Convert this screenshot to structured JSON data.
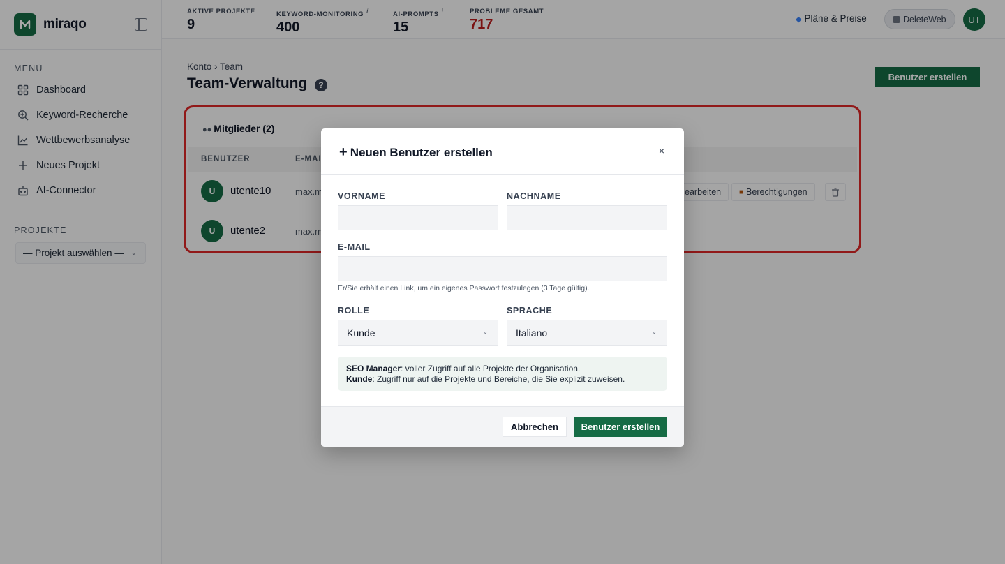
{
  "brand": {
    "name": "miraqo",
    "logo_letter": "M"
  },
  "sidebar": {
    "menu_label": "MENÜ",
    "items": [
      {
        "label": "Dashboard",
        "icon": "grid-icon"
      },
      {
        "label": "Keyword-Recherche",
        "icon": "search-plus-icon"
      },
      {
        "label": "Wettbewerbsanalyse",
        "icon": "line-chart-icon"
      },
      {
        "label": "Neues Projekt",
        "icon": "plus-icon"
      },
      {
        "label": "AI-Connector",
        "icon": "robot-icon"
      }
    ],
    "projects_label": "PROJEKTE",
    "project_select": "— Projekt auswählen —"
  },
  "topbar": {
    "stats": [
      {
        "label": "AKTIVE PROJEKTE",
        "value": "9",
        "info": ""
      },
      {
        "label": "KEYWORD-MONITORING",
        "value": "400",
        "info": "i"
      },
      {
        "label": "AI-PROMPTS",
        "value": "15",
        "info": "i"
      },
      {
        "label": "PROBLEME GESAMT",
        "value": "717",
        "info": ""
      }
    ],
    "plans_label": "Pläne & Preise",
    "workspace_label": "DeleteWeb",
    "avatar_initials": "UT"
  },
  "main": {
    "breadcrumb": "Konto › Team",
    "title": "Team-Verwaltung",
    "help": "?",
    "create_button": "Benutzer erstellen",
    "members": {
      "title": "Mitglieder (2)",
      "columns": [
        "BENUTZER",
        "E-MAIL"
      ],
      "rows": [
        {
          "avatar": "U",
          "name": "utente10",
          "email": "max.m"
        },
        {
          "avatar": "U",
          "name": "utente2",
          "email": "max.m"
        }
      ],
      "edit_label": "earbeiten",
      "permissions_label": "Berechtigungen"
    }
  },
  "modal": {
    "title": "Neuen Benutzer erstellen",
    "close": "×",
    "firstname_label": "VORNAME",
    "lastname_label": "NACHNAME",
    "email_label": "E-MAIL",
    "email_hint": "Er/Sie erhält einen Link, um ein eigenes Passwort festzulegen (3 Tage gültig).",
    "role_label": "ROLLE",
    "role_value": "Kunde",
    "language_label": "SPRACHE",
    "language_value": "Italiano",
    "info_seo_term": "SEO Manager",
    "info_seo_text": ": voller Zugriff auf alle Projekte der Organisation.",
    "info_client_term": "Kunde",
    "info_client_text": ": Zugriff nur auf die Projekte und Bereiche, die Sie explizit zuweisen.",
    "cancel": "Abbrechen",
    "submit": "Benutzer erstellen"
  },
  "colors": {
    "brand": "#166b45",
    "alert": "#b91c1c",
    "highlight": "#dc2626"
  }
}
